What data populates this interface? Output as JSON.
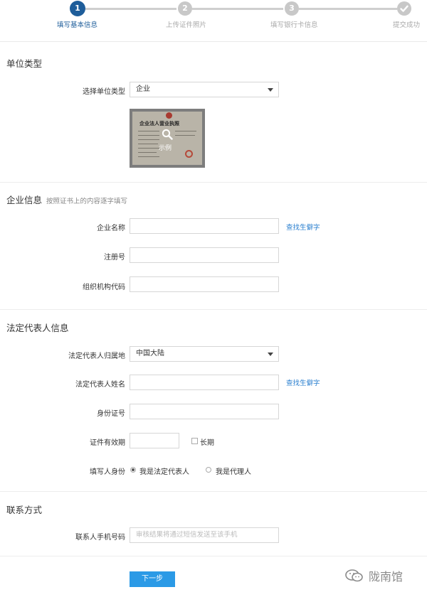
{
  "steps": [
    {
      "number": "1",
      "label": "填写基本信息",
      "active": true
    },
    {
      "number": "2",
      "label": "上传证件照片",
      "active": false
    },
    {
      "number": "3",
      "label": "填写银行卡信息",
      "active": false
    },
    {
      "number": "",
      "label": "提交成功",
      "active": false
    }
  ],
  "unit_type": {
    "section_title": "单位类型",
    "select_label": "选择单位类型",
    "select_value": "企业",
    "sample": {
      "certificate_title": "企业法人营业执照",
      "caption": "示例",
      "magnifier_icon": "search-icon"
    }
  },
  "company_info": {
    "section_title": "企业信息",
    "hint": "按照证书上的内容逐字填写",
    "name_label": "企业名称",
    "name_link": "查找生僻字",
    "reg_label": "注册号",
    "org_label": "组织机构代码"
  },
  "legal_rep": {
    "section_title": "法定代表人信息",
    "region_label": "法定代表人归属地",
    "region_value": "中国大陆",
    "name_label": "法定代表人姓名",
    "name_link": "查找生僻字",
    "id_label": "身份证号",
    "validity_label": "证件有效期",
    "longterm_label": "长期",
    "identity_label": "填写人身份",
    "identity_option_1": "我是法定代表人",
    "identity_option_2": "我是代理人"
  },
  "contact": {
    "section_title": "联系方式",
    "phone_label": "联系人手机号码",
    "phone_placeholder": "审核结果将通过短信发送至该手机"
  },
  "next_button": "下一步",
  "watermark": {
    "icon": "wechat-icon",
    "text": "陇南馆"
  },
  "colors": {
    "active_step": "#1e5d9a",
    "link": "#2a7fcf",
    "button": "#2b9ae6"
  }
}
